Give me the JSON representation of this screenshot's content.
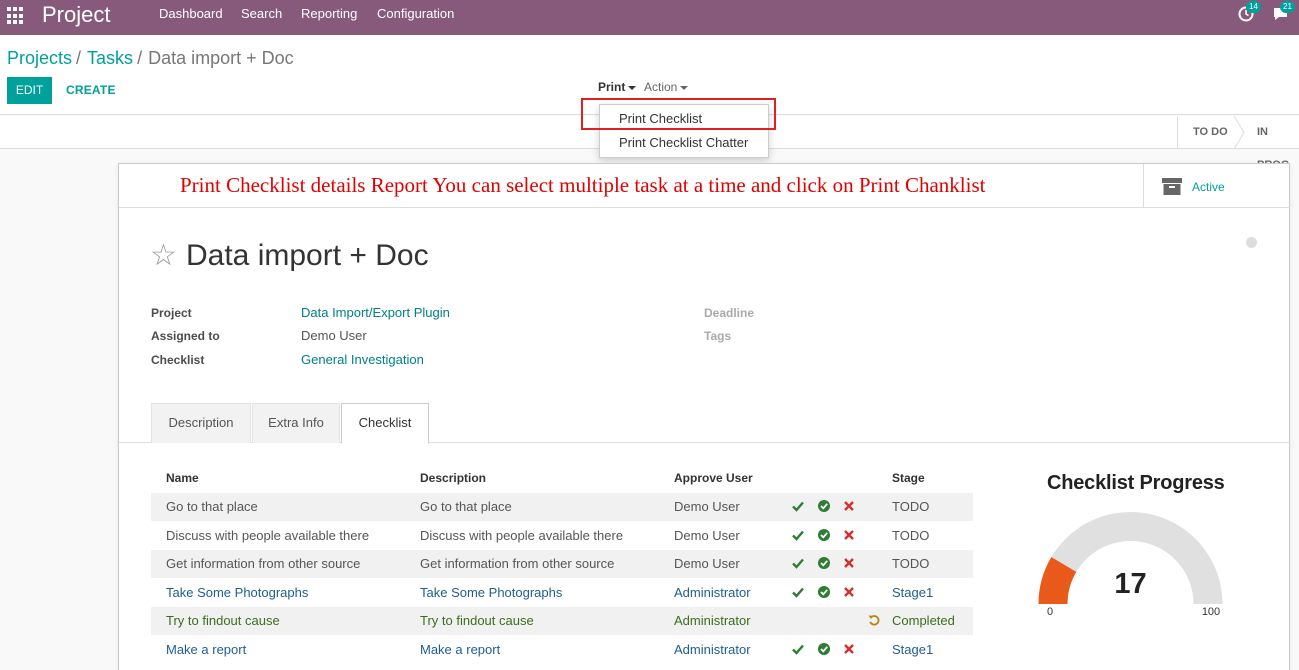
{
  "navbar": {
    "app_title": "Project",
    "menu": [
      "Dashboard",
      "Search",
      "Reporting",
      "Configuration"
    ],
    "activity_count": "14",
    "messages_count": "21"
  },
  "breadcrumb": {
    "items": [
      "Projects",
      "Tasks"
    ],
    "current": "Data import + Doc"
  },
  "buttons": {
    "edit": "EDIT",
    "create": "CREATE"
  },
  "sidebar": {
    "print": "Print",
    "action": "Action",
    "print_menu": [
      "Print Checklist",
      "Print Checklist Chatter"
    ]
  },
  "statusbar": {
    "stages": [
      "TO DO",
      "IN PROG"
    ]
  },
  "annotation": "Print Checklist details Report You can select multiple task at a time and click on Print Chanklist",
  "active_button": "Active",
  "task": {
    "name": "Data import + Doc",
    "fields": {
      "project_label": "Project",
      "project": "Data Import/Export Plugin",
      "assigned_label": "Assigned to",
      "assigned": "Demo User",
      "checklist_label": "Checklist",
      "checklist": "General Investigation",
      "deadline_label": "Deadline",
      "tags_label": "Tags"
    }
  },
  "tabs": [
    "Description",
    "Extra Info",
    "Checklist"
  ],
  "active_tab": "Checklist",
  "checklist": {
    "headers": [
      "Name",
      "Description",
      "Approve User",
      "Stage"
    ],
    "rows": [
      {
        "name": "Go to that place",
        "description": "Go to that place",
        "user": "Demo User",
        "stage": "TODO",
        "actions": [
          "approve",
          "done",
          "reject"
        ],
        "style": "plain"
      },
      {
        "name": "Discuss with people available there",
        "description": "Discuss with people available there",
        "user": "Demo User",
        "stage": "TODO",
        "actions": [
          "approve",
          "done",
          "reject"
        ],
        "style": "plain"
      },
      {
        "name": "Get information from other source",
        "description": "Get information from other source",
        "user": "Demo User",
        "stage": "TODO",
        "actions": [
          "approve",
          "done",
          "reject"
        ],
        "style": "plain"
      },
      {
        "name": "Take Some Photographs",
        "description": "Take Some Photographs",
        "user": "Administrator",
        "stage": "Stage1",
        "actions": [
          "approve",
          "done",
          "reject"
        ],
        "style": "blue"
      },
      {
        "name": "Try to findout cause",
        "description": "Try to findout cause",
        "user": "Administrator",
        "stage": "Completed",
        "actions": [
          "reset"
        ],
        "style": "green"
      },
      {
        "name": "Make a report",
        "description": "Make a report",
        "user": "Administrator",
        "stage": "Stage1",
        "actions": [
          "approve",
          "done",
          "reject"
        ],
        "style": "blue"
      }
    ]
  },
  "progress": {
    "title": "Checklist Progress",
    "value": 17,
    "min": "0",
    "max": "100",
    "colors": {
      "fill": "#e8591a",
      "track": "#e0e0e0"
    }
  },
  "colors": {
    "navbar": "#875a7b",
    "accent": "#00a09d",
    "annotation": "#e00000",
    "row_plain": "#555555",
    "row_blue": "#1f5d91",
    "row_green": "#3b6e1c",
    "approve": "#2e7d32",
    "reject": "#d32f2f",
    "reset": "#b8860b"
  }
}
